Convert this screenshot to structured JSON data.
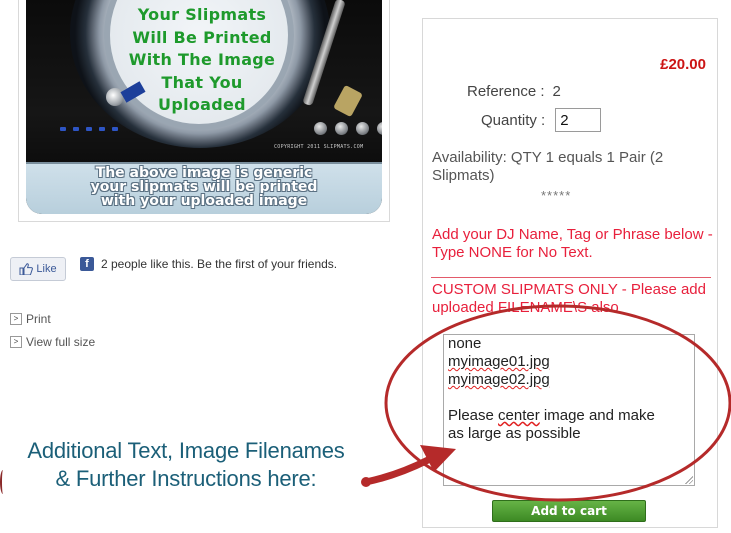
{
  "product_image": {
    "platter_lines": [
      "Your Slipmats",
      "Will Be Printed",
      "With The Image",
      "That You",
      "Uploaded"
    ],
    "banner_lines": [
      "The above image is generic",
      "your slipmats will be printed",
      "with your uploaded image"
    ],
    "copyright": "COPYRIGHT 2011 SLIPMATS.COM"
  },
  "social": {
    "like_label": "Like",
    "fb_icon_letter": "f",
    "like_text": "2 people like this. Be the first of your friends."
  },
  "actions": {
    "print_label": "Print",
    "view_label": "View full size",
    "arrow_glyph": ">"
  },
  "callout": {
    "line1": "Additional Text, Image Filenames",
    "line2": "& Further Instructions here:"
  },
  "panel": {
    "price": "£20.00",
    "reference_label": "Reference :",
    "reference_value": "2",
    "quantity_label": "Quantity :",
    "quantity_value": "2",
    "availability": "Availability:  QTY 1 equals 1 Pair (2 Slipmats)",
    "stars": "*****",
    "dj_note": "Add your DJ Name, Tag or Phrase below - Type NONE for No Text.",
    "custom_note": "CUSTOM SLIPMATS ONLY - Please add uploaded FILENAME\\S also",
    "notes": {
      "line1": "none",
      "line2": "myimage01.jpg",
      "line3": "myimage02.jpg",
      "line4_a": "Please ",
      "line4_b": "center",
      "line4_c": " image and make",
      "line5": "as large as possible"
    },
    "add_to_cart": "Add to cart"
  },
  "colors": {
    "price_red": "#cc1414",
    "note_red": "#e8203c",
    "annotation_red": "#b52a2a",
    "callout_teal": "#1b5f78",
    "platter_green": "#1e9a2c",
    "button_green": "#4a9c2e",
    "facebook_blue": "#3b5998"
  },
  "icons": {
    "like": "thumbs-up-icon",
    "facebook": "facebook-icon",
    "arrow": "arrow-right-icon"
  }
}
